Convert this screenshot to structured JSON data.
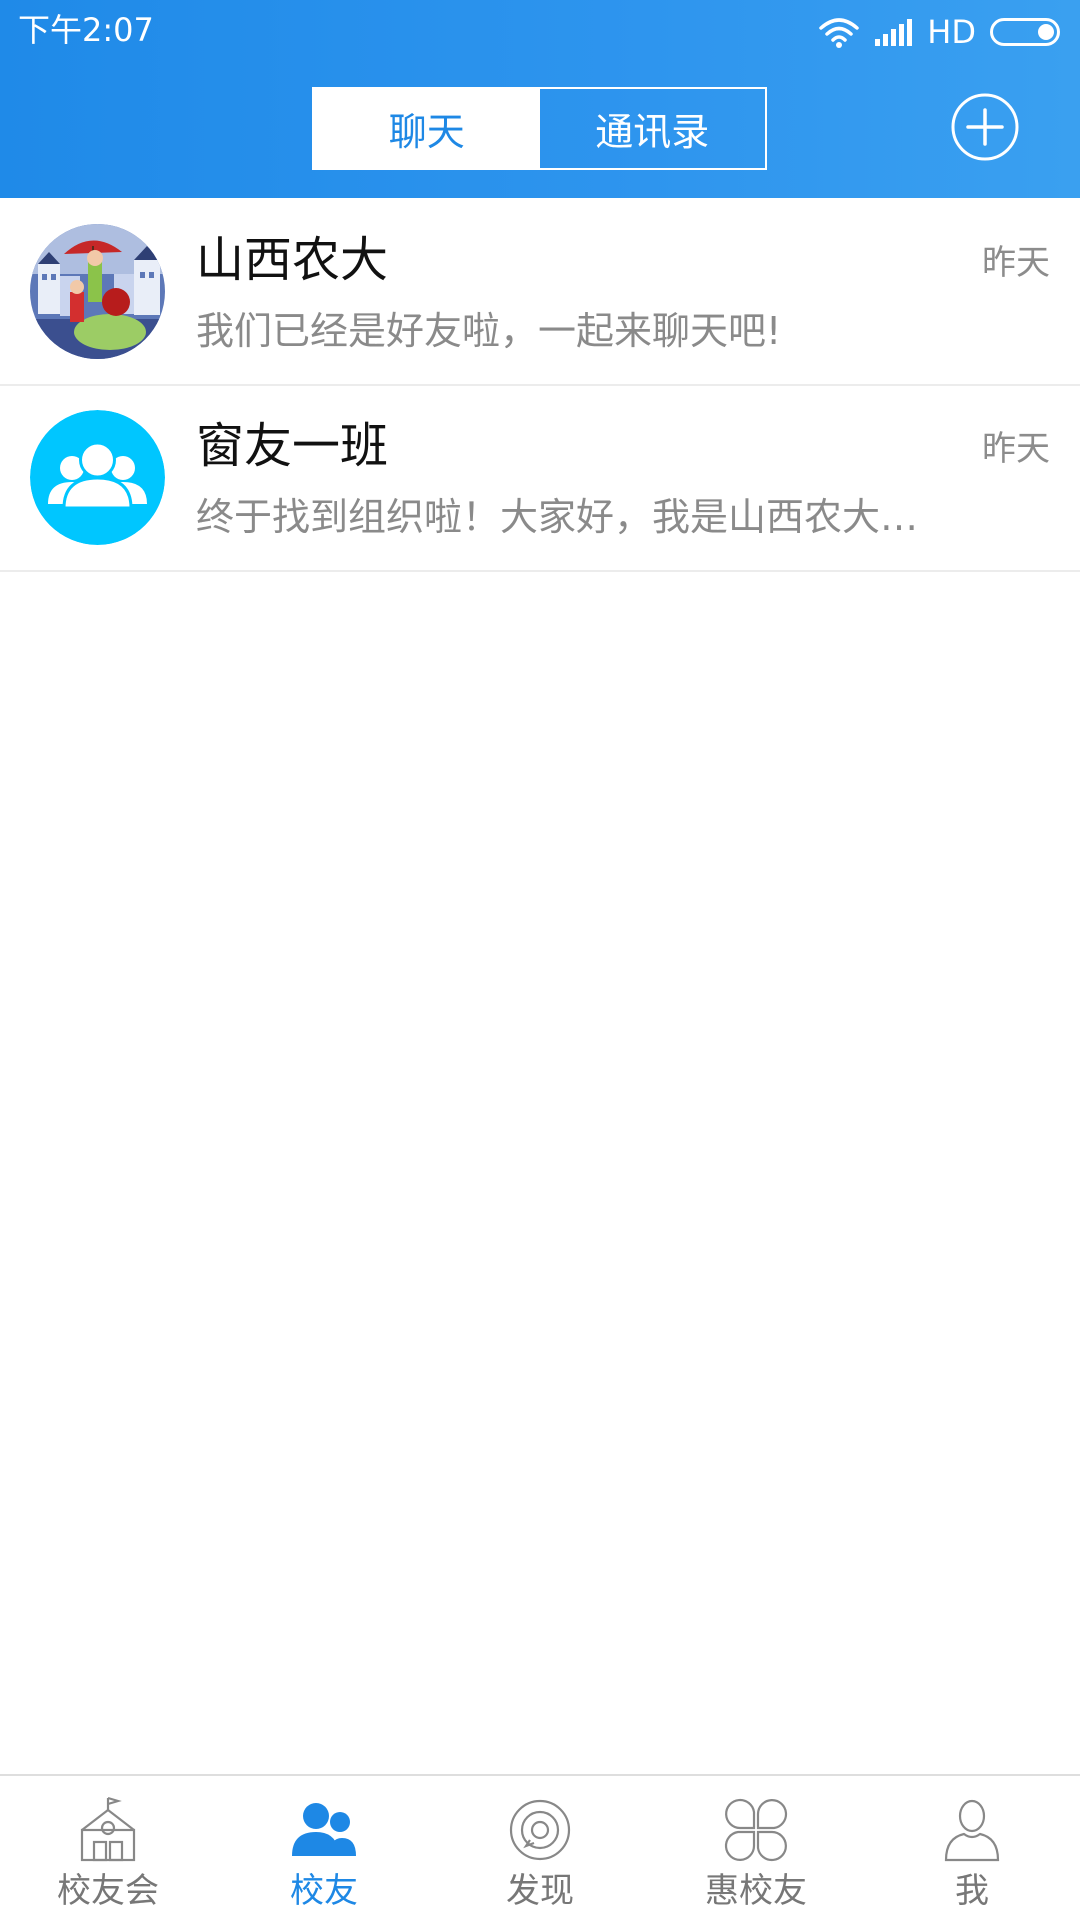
{
  "status_bar": {
    "time": "下午2:07",
    "network": "HD"
  },
  "header": {
    "tabs": [
      {
        "label": "聊天",
        "active": true
      },
      {
        "label": "通讯录",
        "active": false
      }
    ],
    "add_icon": "plus-circle-icon"
  },
  "chats": [
    {
      "name": "山西农大",
      "time": "昨天",
      "preview": "我们已经是好友啦，一起来聊天吧!",
      "avatar_icon": "illustration-avatar"
    },
    {
      "name": "窗友一班",
      "time": "昨天",
      "preview": "终于找到组织啦！大家好，我是山西农大…",
      "avatar_icon": "group-avatar-icon"
    }
  ],
  "bottom_nav": [
    {
      "label": "校友会",
      "icon": "school-building-icon",
      "active": false
    },
    {
      "label": "校友",
      "icon": "contacts-icon",
      "active": true
    },
    {
      "label": "发现",
      "icon": "discover-icon",
      "active": false
    },
    {
      "label": "惠校友",
      "icon": "clover-icon",
      "active": false
    },
    {
      "label": "我",
      "icon": "person-icon",
      "active": false
    }
  ],
  "colors": {
    "primary": "#1E88E5",
    "group_avatar": "#00C6FF",
    "inactive_text": "#777777",
    "divider": "#ECECEC"
  }
}
